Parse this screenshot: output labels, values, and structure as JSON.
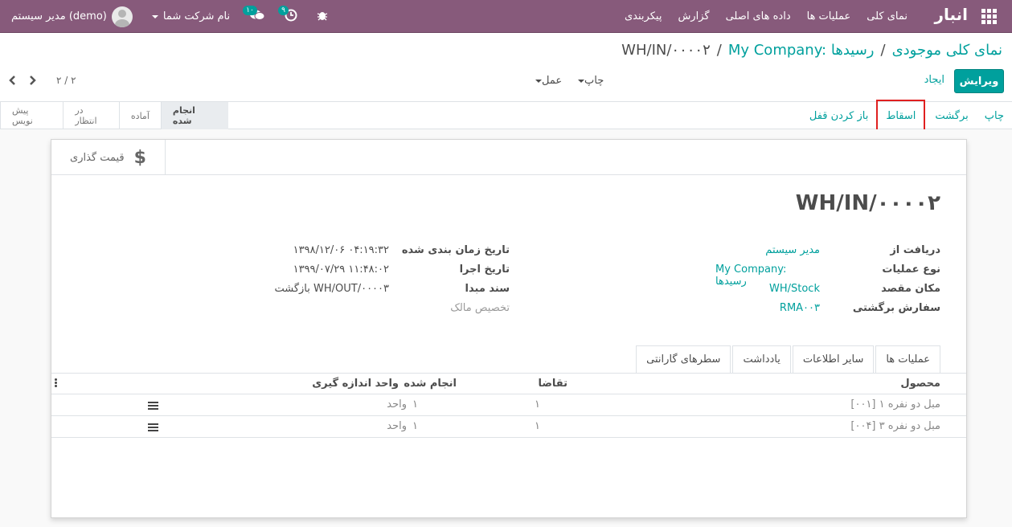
{
  "navbar": {
    "brand": "انبار",
    "menu": [
      "نمای کلی",
      "عملیات ها",
      "داده های اصلی",
      "گزارش",
      "پیکربندی"
    ],
    "user_name": "مدیر سیستم (demo)",
    "company": "نام شرکت شما",
    "messages_badge": "۱۰",
    "activities_badge": "۹"
  },
  "breadcrumb": {
    "root": "نمای کلی موجودی",
    "parent": "My Company: رسیدها",
    "current": "WH/IN/۰۰۰۰۲",
    "separator": "/"
  },
  "control_panel": {
    "edit_label": "ویرایش",
    "create_label": "ایجاد",
    "print_label": "چاپ",
    "action_label": "عمل",
    "pager": "۲ / ۲"
  },
  "statusbar": {
    "actions": [
      {
        "label": "چاپ",
        "highlight": false
      },
      {
        "label": "برگشت",
        "highlight": false
      },
      {
        "label": "اسقاط",
        "highlight": true
      },
      {
        "label": "باز کردن قفل",
        "highlight": false
      }
    ],
    "stages": [
      {
        "label": "انجام شده",
        "active": true
      },
      {
        "label": "آماده",
        "active": false
      },
      {
        "label": "در انتظار",
        "active": false
      },
      {
        "label": "پیش نویس",
        "active": false
      }
    ]
  },
  "smart_button": {
    "label": "قیمت گذاری",
    "icon": "dollar-icon"
  },
  "record": {
    "title": "WH/IN/۰۰۰۰۲",
    "right_fields": [
      {
        "label": "دریافت از",
        "value": "مدیر سیستم",
        "style": "link"
      },
      {
        "label": "نوع عملیات",
        "value": "My Company: رسیدها",
        "style": "link"
      },
      {
        "label": "مکان مقصد",
        "value": "WH/Stock",
        "style": "link"
      },
      {
        "label": "سفارش برگشتی",
        "value": "RMA۰۰۳",
        "style": "link"
      }
    ],
    "left_fields": [
      {
        "label": "تاریخ زمان بندی شده",
        "value": "۱۳۹۸/۱۲/۰۶ ۰۴:۱۹:۳۲",
        "style": "plain"
      },
      {
        "label": "تاریخ اجرا",
        "value": "۱۳۹۹/۰۷/۲۹ ۱۱:۴۸:۰۲",
        "style": "plain"
      },
      {
        "label": "سند مبدا",
        "value": "بازگشت WH/OUT/۰۰۰۰۳",
        "style": "plain"
      },
      {
        "label": "",
        "value": "تخصیص مالک",
        "style": "muted"
      }
    ]
  },
  "tabs": [
    "عملیات ها",
    "سایر اطلاعات",
    "یادداشت",
    "سطرهای گارانتی"
  ],
  "table": {
    "columns": {
      "product": "محصول",
      "demand": "تقاضا",
      "done": "انجام شده",
      "uom": "واحد اندازه گیری"
    },
    "rows": [
      {
        "product": "[۰۰۱] مبل دو نفره ۱",
        "demand": "۱",
        "done": "۱",
        "uom": "واحد"
      },
      {
        "product": "[۰۰۴] مبل دو نفره ۳",
        "demand": "۱",
        "done": "۱",
        "uom": "واحد"
      }
    ]
  },
  "colors": {
    "brand": "#875a7b",
    "accent": "#00a09d",
    "highlight_box": "#e02020"
  }
}
